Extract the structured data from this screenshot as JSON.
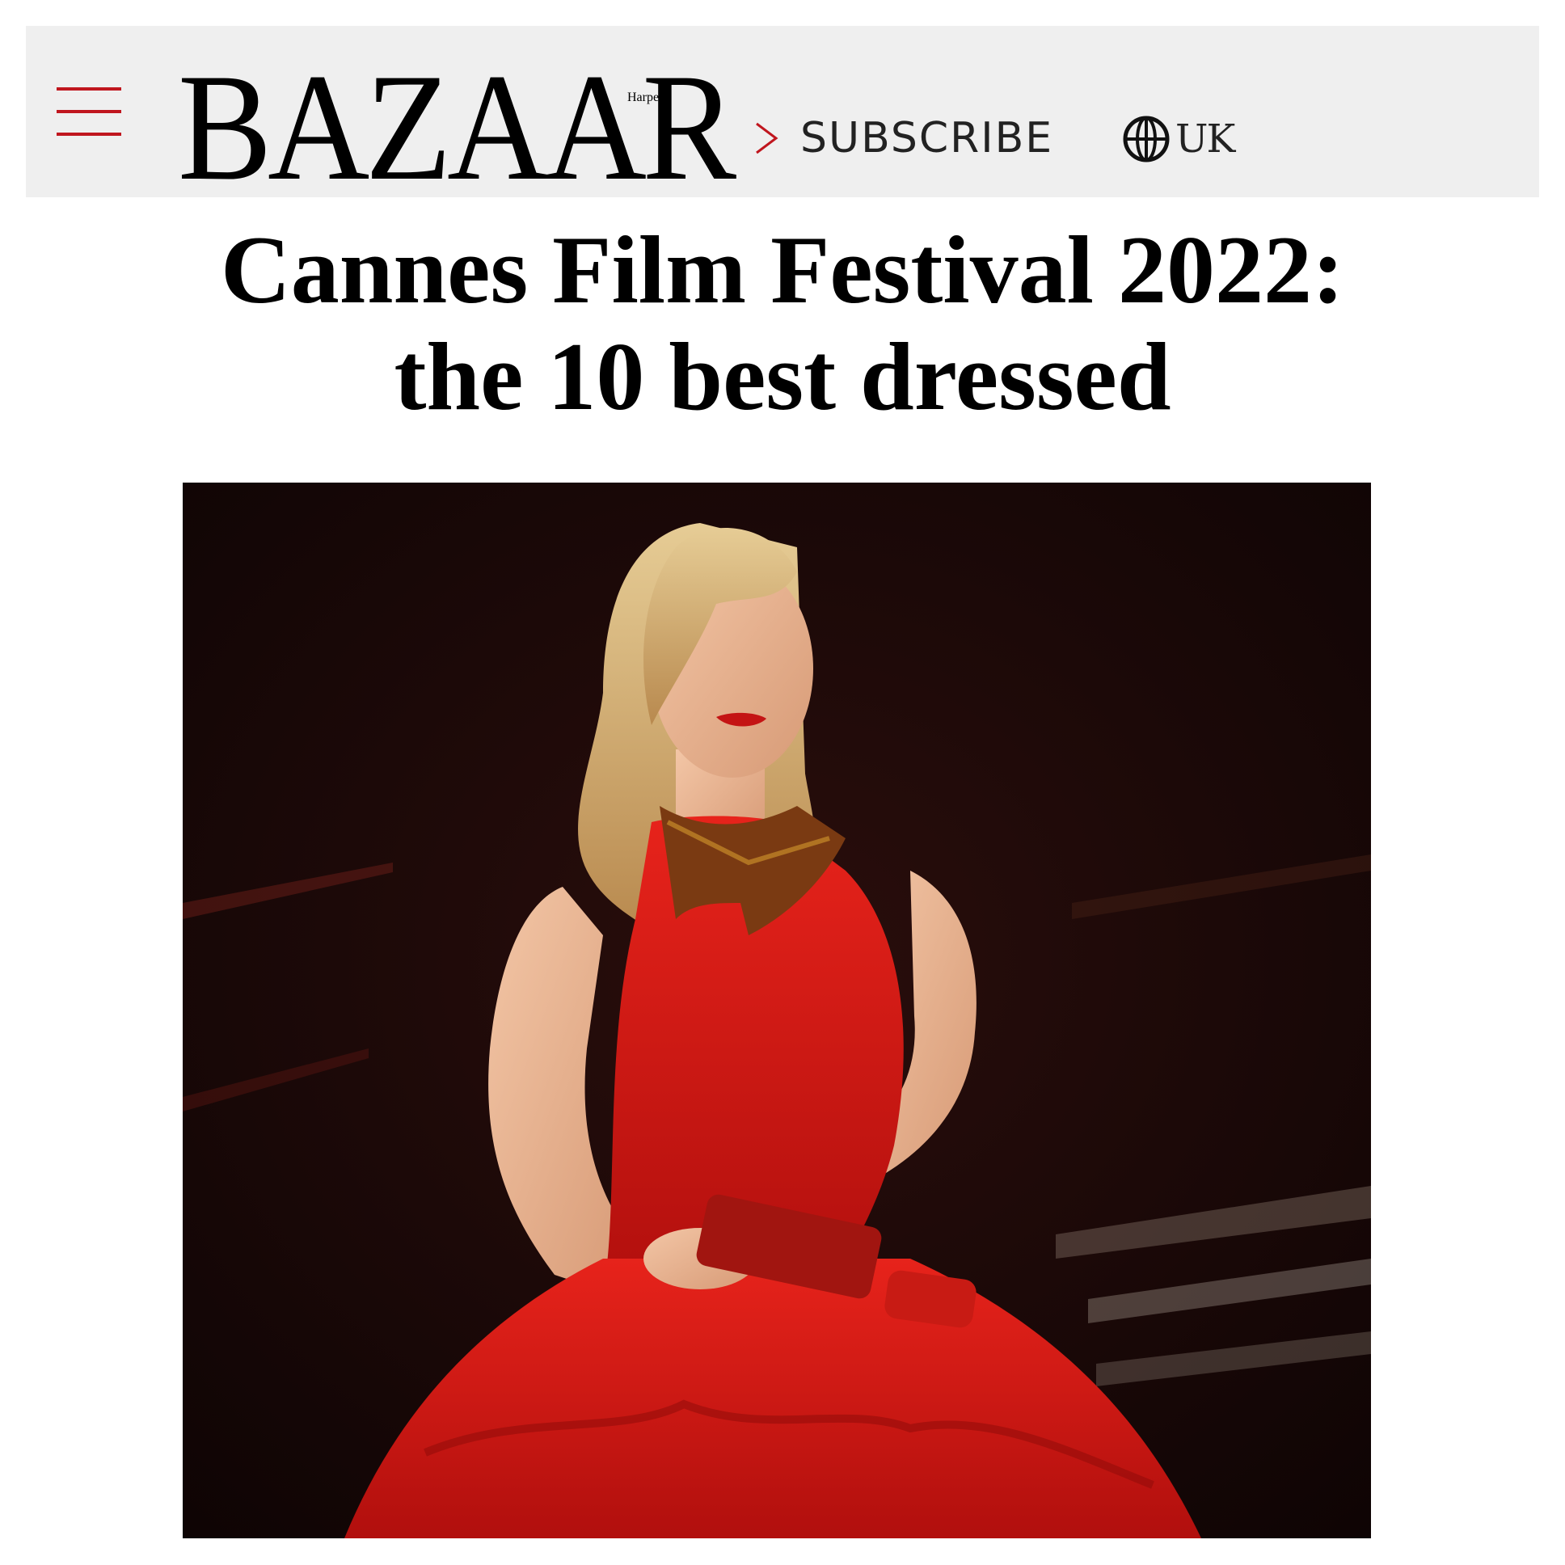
{
  "header": {
    "logo_wordmark": "BAZAAR",
    "logo_superscript": "Harper's",
    "subscribe_label": "SUBSCRIBE",
    "region_label": "UK",
    "brand_color": "#c0161e",
    "background": "#efefef"
  },
  "article": {
    "headline_line1": "Cannes Film Festival 2022:",
    "headline_line2": "the 10 best dressed"
  },
  "icons": {
    "menu": "hamburger-menu-icon",
    "subscribe": "chevron-right-icon",
    "region": "globe-icon"
  }
}
